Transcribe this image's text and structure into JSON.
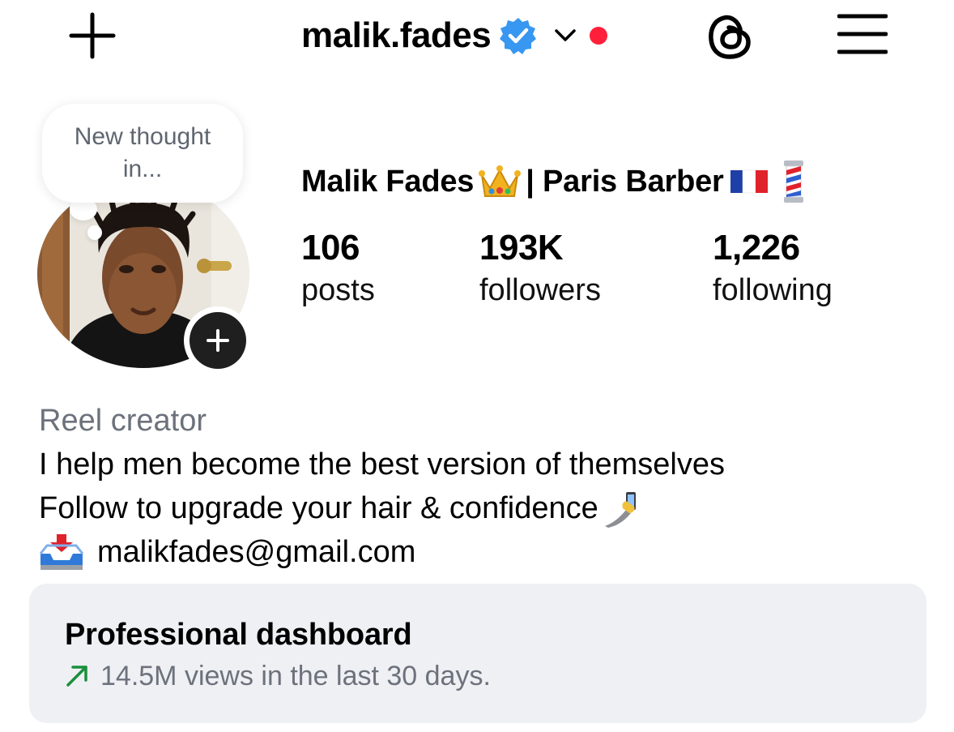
{
  "header": {
    "username": "malik.fades",
    "colors": {
      "verified": "#3897f0",
      "notification_dot": "#ff1f3a"
    },
    "icons": [
      "plus-icon",
      "verified-badge-icon",
      "chevron-down-icon",
      "threads-icon",
      "menu-icon"
    ]
  },
  "note": {
    "text": "New thought in..."
  },
  "profile": {
    "name_part1": "Malik Fades",
    "name_part2": "| Paris Barber",
    "name_emojis": [
      "crown-icon",
      "france-flag-icon",
      "barber-pole-icon"
    ]
  },
  "stats": [
    {
      "value": "106",
      "label": "posts"
    },
    {
      "value": "193K",
      "label": "followers"
    },
    {
      "value": "1,226",
      "label": "following"
    }
  ],
  "bio": {
    "category": "Reel creator",
    "line1": "I help men become the best version of themselves",
    "line2": "Follow to upgrade your hair & confidence",
    "email": "malikfades@gmail.com",
    "icons": [
      "selfie-hand-icon",
      "inbox-tray-icon"
    ]
  },
  "dashboard": {
    "title": "Professional dashboard",
    "subtitle": "14.5M views in the last 30 days.",
    "colors": {
      "trend": "#1a8f3c"
    }
  }
}
